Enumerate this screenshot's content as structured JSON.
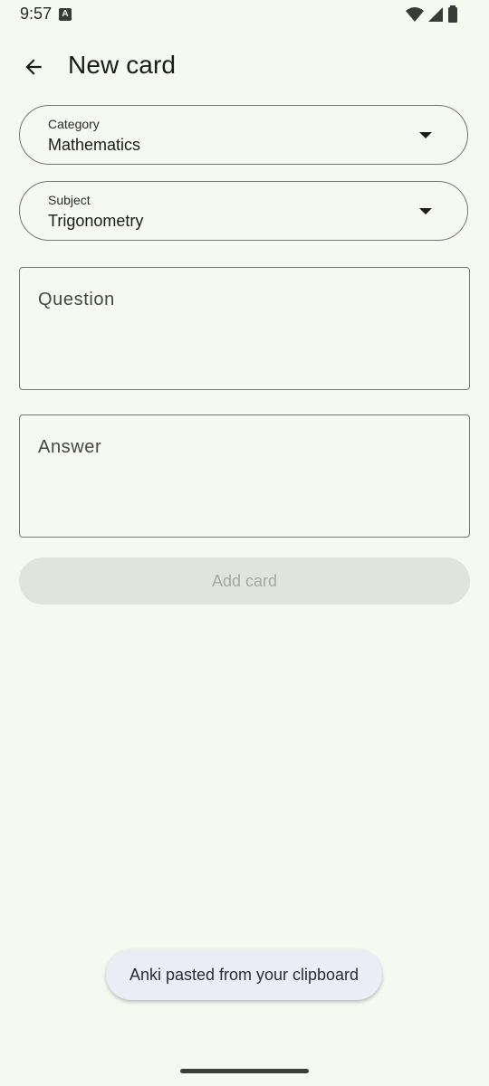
{
  "status_bar": {
    "time": "9:57",
    "app_icon_letter": "A",
    "icons": [
      "wifi-icon",
      "signal-icon",
      "battery-icon"
    ]
  },
  "header": {
    "title": "New card",
    "back_icon": "arrow-back-icon"
  },
  "form": {
    "category": {
      "label": "Category",
      "value": "Mathematics"
    },
    "subject": {
      "label": "Subject",
      "value": "Trigonometry"
    },
    "question": {
      "label": "Question",
      "value": ""
    },
    "answer": {
      "label": "Answer",
      "value": ""
    },
    "add_button_label": "Add card"
  },
  "toast": {
    "message": "Anki pasted from your clipboard"
  },
  "colors": {
    "background": "#f6f9f0",
    "outline": "#74796d",
    "disabled_button": "#e1e4da",
    "toast_bg": "#ececf6"
  }
}
